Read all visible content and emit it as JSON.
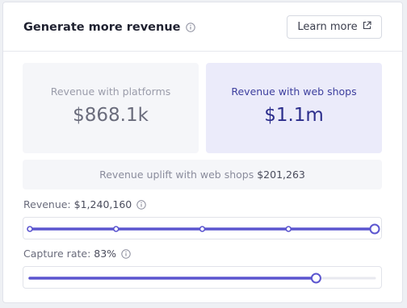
{
  "header": {
    "title": "Generate more revenue",
    "info_icon": "info-icon",
    "learn_more_label": "Learn more",
    "external_link_icon": "external-link-icon"
  },
  "platforms": {
    "label": "Revenue with platforms",
    "value": "$868.1k"
  },
  "webshops": {
    "label": "Revenue with web shops",
    "value": "$1.1m"
  },
  "uplift": {
    "label": "Revenue uplift with web shops",
    "value": "$201,263"
  },
  "revenue_slider": {
    "label": "Revenue:",
    "value": "$1,240,160",
    "position": 1.0,
    "step_marks": 5
  },
  "capture_slider": {
    "label": "Capture rate:",
    "value": "83%",
    "position": 0.83
  },
  "colors": {
    "accent": "#5b55cf",
    "track": "#e8e9ef",
    "page_background": "#eef0f4"
  }
}
